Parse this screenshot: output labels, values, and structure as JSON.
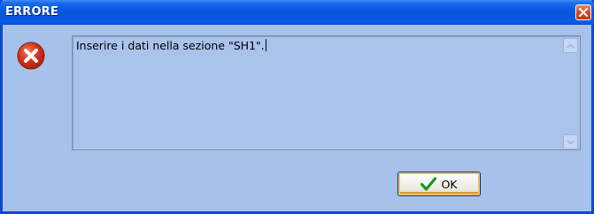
{
  "dialog": {
    "title": "ERRORE",
    "message": "Inserire i dati nella sezione \"SH1\".",
    "ok_label": "OK",
    "icons": {
      "close": "close-icon",
      "error": "error-icon",
      "scroll_up": "chevron-up-icon",
      "scroll_down": "chevron-down-icon",
      "ok": "checkmark-icon"
    },
    "colors": {
      "titlebar": "#0753dc",
      "body": "#a6c1ea",
      "error_icon": "#d2321c",
      "close_button": "#d9421c",
      "check": "#1a9a1a"
    }
  }
}
